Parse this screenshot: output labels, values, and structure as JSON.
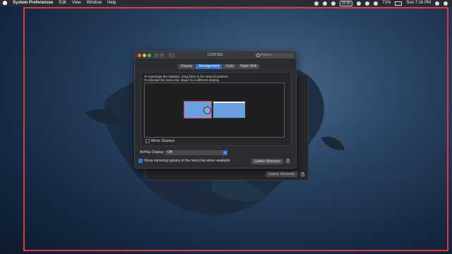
{
  "menubar": {
    "app_name": "System Preferences",
    "menus": [
      "Edit",
      "View",
      "Window",
      "Help"
    ],
    "clock_box": "10:00",
    "battery": "71%",
    "datetime": "Sun 7:16 PM"
  },
  "window": {
    "title": "C32F391",
    "search_placeholder": "Search",
    "tabs": [
      "Display",
      "Arrangement",
      "Color",
      "Night Shift"
    ],
    "active_tab": "Arrangement",
    "instruction_1": "To rearrange the displays, drag them to the desired position.",
    "instruction_2": "To relocate the menu bar, drag it to a different display.",
    "mirror_label": "Mirror Displays",
    "airplay_label": "AirPlay Display:",
    "airplay_value": "Off",
    "show_mirroring_label": "Show mirroring options in the menu bar when available",
    "gather_label": "Gather Windows",
    "help_label": "?"
  },
  "background_window": {
    "gather_label": "Gather Windows",
    "help_label": "?"
  },
  "colors": {
    "accent": "#2f6fd6",
    "display": "#6b9fdf",
    "highlight": "#e0383b"
  }
}
